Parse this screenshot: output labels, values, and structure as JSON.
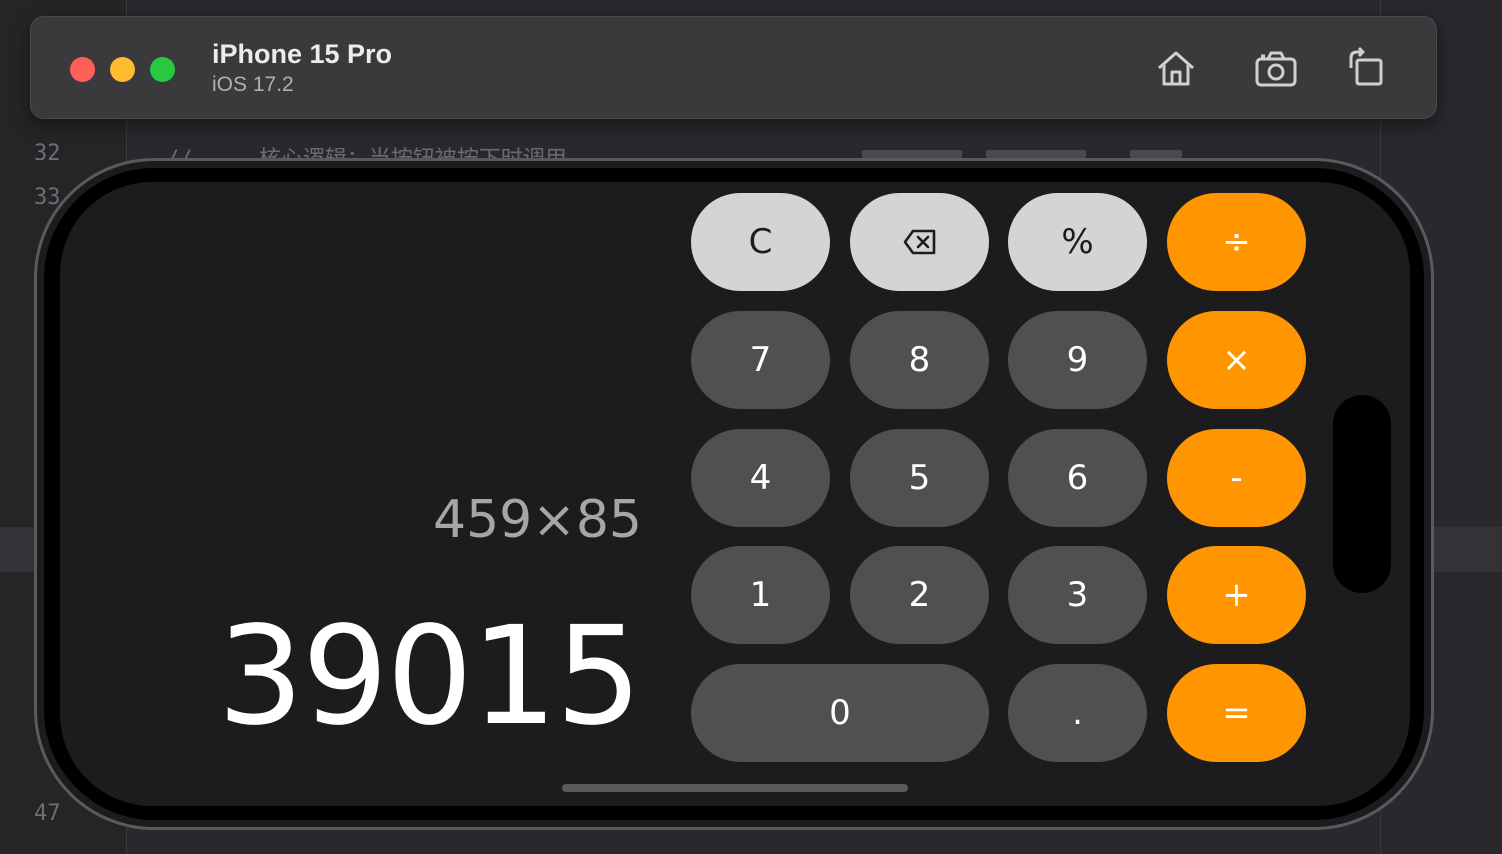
{
  "editor": {
    "line_numbers": [
      "32",
      "33",
      "47"
    ],
    "code_comment": "// --- 核心逻辑：当按钮被按下时调用 ---"
  },
  "titlebar": {
    "device_name": "iPhone 15 Pro",
    "os_version": "iOS 17.2",
    "icons": [
      "home-icon",
      "screenshot-icon",
      "rotate-icon"
    ]
  },
  "calculator": {
    "expression": "459×85",
    "result": "39015",
    "keys": {
      "clear": "C",
      "backspace": "backspace-icon",
      "percent": "%",
      "divide": "÷",
      "seven": "7",
      "eight": "8",
      "nine": "9",
      "multiply": "×",
      "four": "4",
      "five": "5",
      "six": "6",
      "minus": "-",
      "one": "1",
      "two": "2",
      "three": "3",
      "plus": "+",
      "zero": "0",
      "decimal": ".",
      "equals": "="
    },
    "colors": {
      "function_key": "#d4d4d2",
      "number_key": "#505050",
      "operator_key": "#ff9500",
      "background": "#1c1c1e"
    }
  }
}
